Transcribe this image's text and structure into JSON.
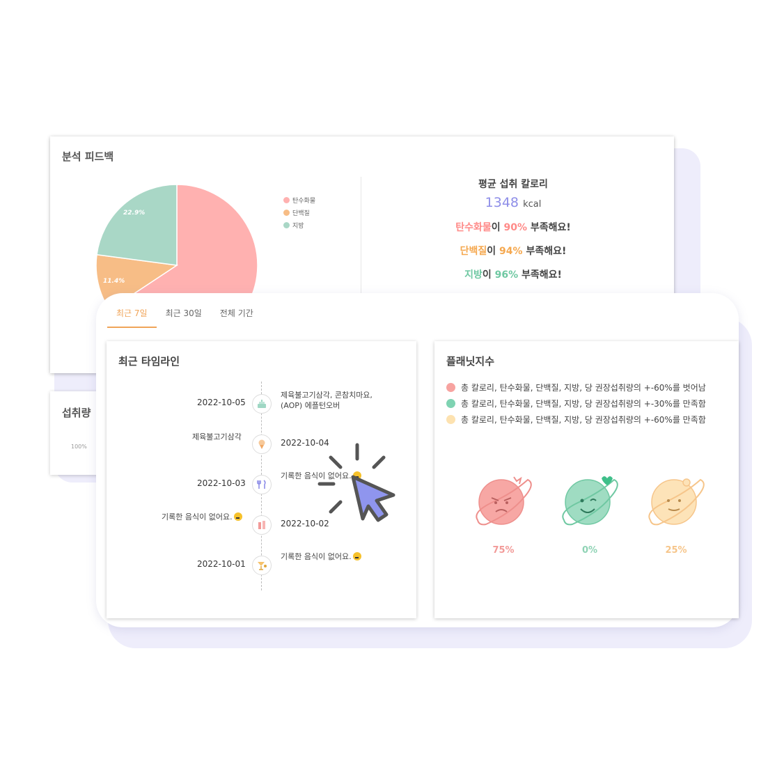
{
  "analysis": {
    "title": "분석 피드백",
    "legend": [
      {
        "label": "탄수화물",
        "color": "#ffb1b0"
      },
      {
        "label": "단백질",
        "color": "#f7bd86"
      },
      {
        "label": "지방",
        "color": "#a9d7c6"
      }
    ],
    "pie_labels": [
      "22.9%",
      "11.4%"
    ],
    "avg_label": "평균 섭취 칼로리",
    "avg_value": "1348",
    "avg_unit": "kcal",
    "deficits": [
      {
        "nutrient": "탄수화물",
        "particle": "이",
        "percent": "90%",
        "suffix": "부족해요!",
        "color": "#ff8a88"
      },
      {
        "nutrient": "단백질",
        "particle": "이",
        "percent": "94%",
        "suffix": "부족해요!",
        "color": "#f5a84f"
      },
      {
        "nutrient": "지방",
        "particle": "이",
        "percent": "96%",
        "suffix": "부족해요!",
        "color": "#6fc8a2"
      }
    ]
  },
  "chart_data": {
    "type": "pie",
    "categories": [
      "탄수화물",
      "단백질",
      "지방"
    ],
    "values": [
      65.7,
      11.4,
      22.9
    ],
    "colors": [
      "#ffb1b0",
      "#f7bd86",
      "#a9d7c6"
    ]
  },
  "intake": {
    "title": "섭취량 ",
    "pct": "100%"
  },
  "tabs": [
    "최근 7일",
    "최근 30일",
    "전체 기간"
  ],
  "timeline": {
    "title": "최근 타임라인",
    "entries": [
      {
        "date": "2022-10-05",
        "text": "제육불고기삼각, 콘참치마요, (AOP) 에플턴오버",
        "text2": "(AOP) 에플턴오버"
      },
      {
        "date": "2022-10-04",
        "text": "제육불고기삼각"
      },
      {
        "date": "2022-10-03",
        "text": "기록한 음식이 없어요."
      },
      {
        "date": "2022-10-02",
        "text": "기록한 음식이 없어요."
      },
      {
        "date": "2022-10-01",
        "text": "기록한 음식이 없어요."
      }
    ],
    "line1a": "제육불고기삼각, 콘참치마요,"
  },
  "planet": {
    "title": "플래닛지수",
    "criteria": [
      {
        "text": "총 칼로리, 탄수화물, 단백질, 지방, 당 권장섭취량의 +-60%를 벗어남",
        "color": "#f7a3a0"
      },
      {
        "text": "총 칼로리, 탄수화물, 단백질, 지방, 당 권장섭취량의 +-30%를 만족함",
        "color": "#7fd3b2"
      },
      {
        "text": "총 칼로리, 탄수화물, 단백질, 지방, 당 권장섭취량의 +-60%를 만족함",
        "color": "#fde2b0"
      }
    ],
    "scores": [
      {
        "pct": "75%",
        "color": "#f29a98"
      },
      {
        "pct": "0%",
        "color": "#8fd3b5"
      },
      {
        "pct": "25%",
        "color": "#f6c58a"
      }
    ]
  }
}
